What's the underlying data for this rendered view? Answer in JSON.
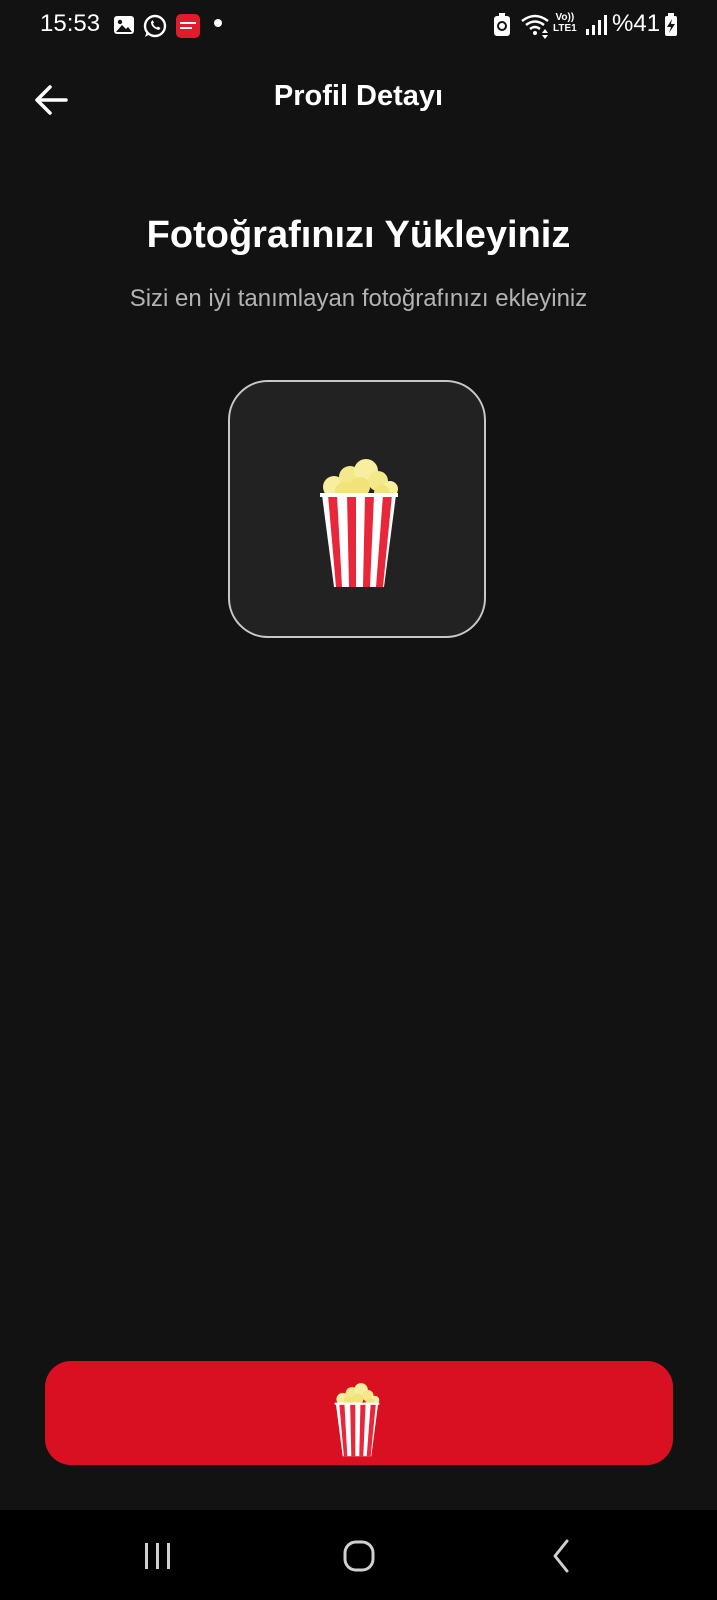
{
  "status_bar": {
    "time": "15:53",
    "network_line1": "Vo))",
    "network_line2": "LTE1",
    "battery": "%41",
    "icons": [
      "gallery-icon",
      "whatsapp-icon",
      "app-notification-icon",
      "notification-dot",
      "battery-saver-icon",
      "wifi-icon",
      "signal-icon",
      "battery-charging-icon"
    ]
  },
  "header": {
    "title": "Profil Detayı",
    "back_icon": "arrow-left-icon"
  },
  "upload": {
    "heading": "Fotoğrafınızı Yükleyiniz",
    "subheading": "Sizi en iyi tanımlayan fotoğrafınızı ekleyiniz",
    "placeholder_icon": "popcorn-icon"
  },
  "cta_button": {
    "icon": "popcorn-icon",
    "color": "#d90f22"
  },
  "nav_bar": {
    "items": [
      "recent-apps-icon",
      "home-icon",
      "back-icon"
    ]
  },
  "colors": {
    "background": "#121212",
    "accent": "#d90f22",
    "box_fill": "#222222",
    "box_border": "#c8c8c8",
    "popcorn_kernel": "#f7ef9f",
    "popcorn_stripe": "#e8283a"
  }
}
